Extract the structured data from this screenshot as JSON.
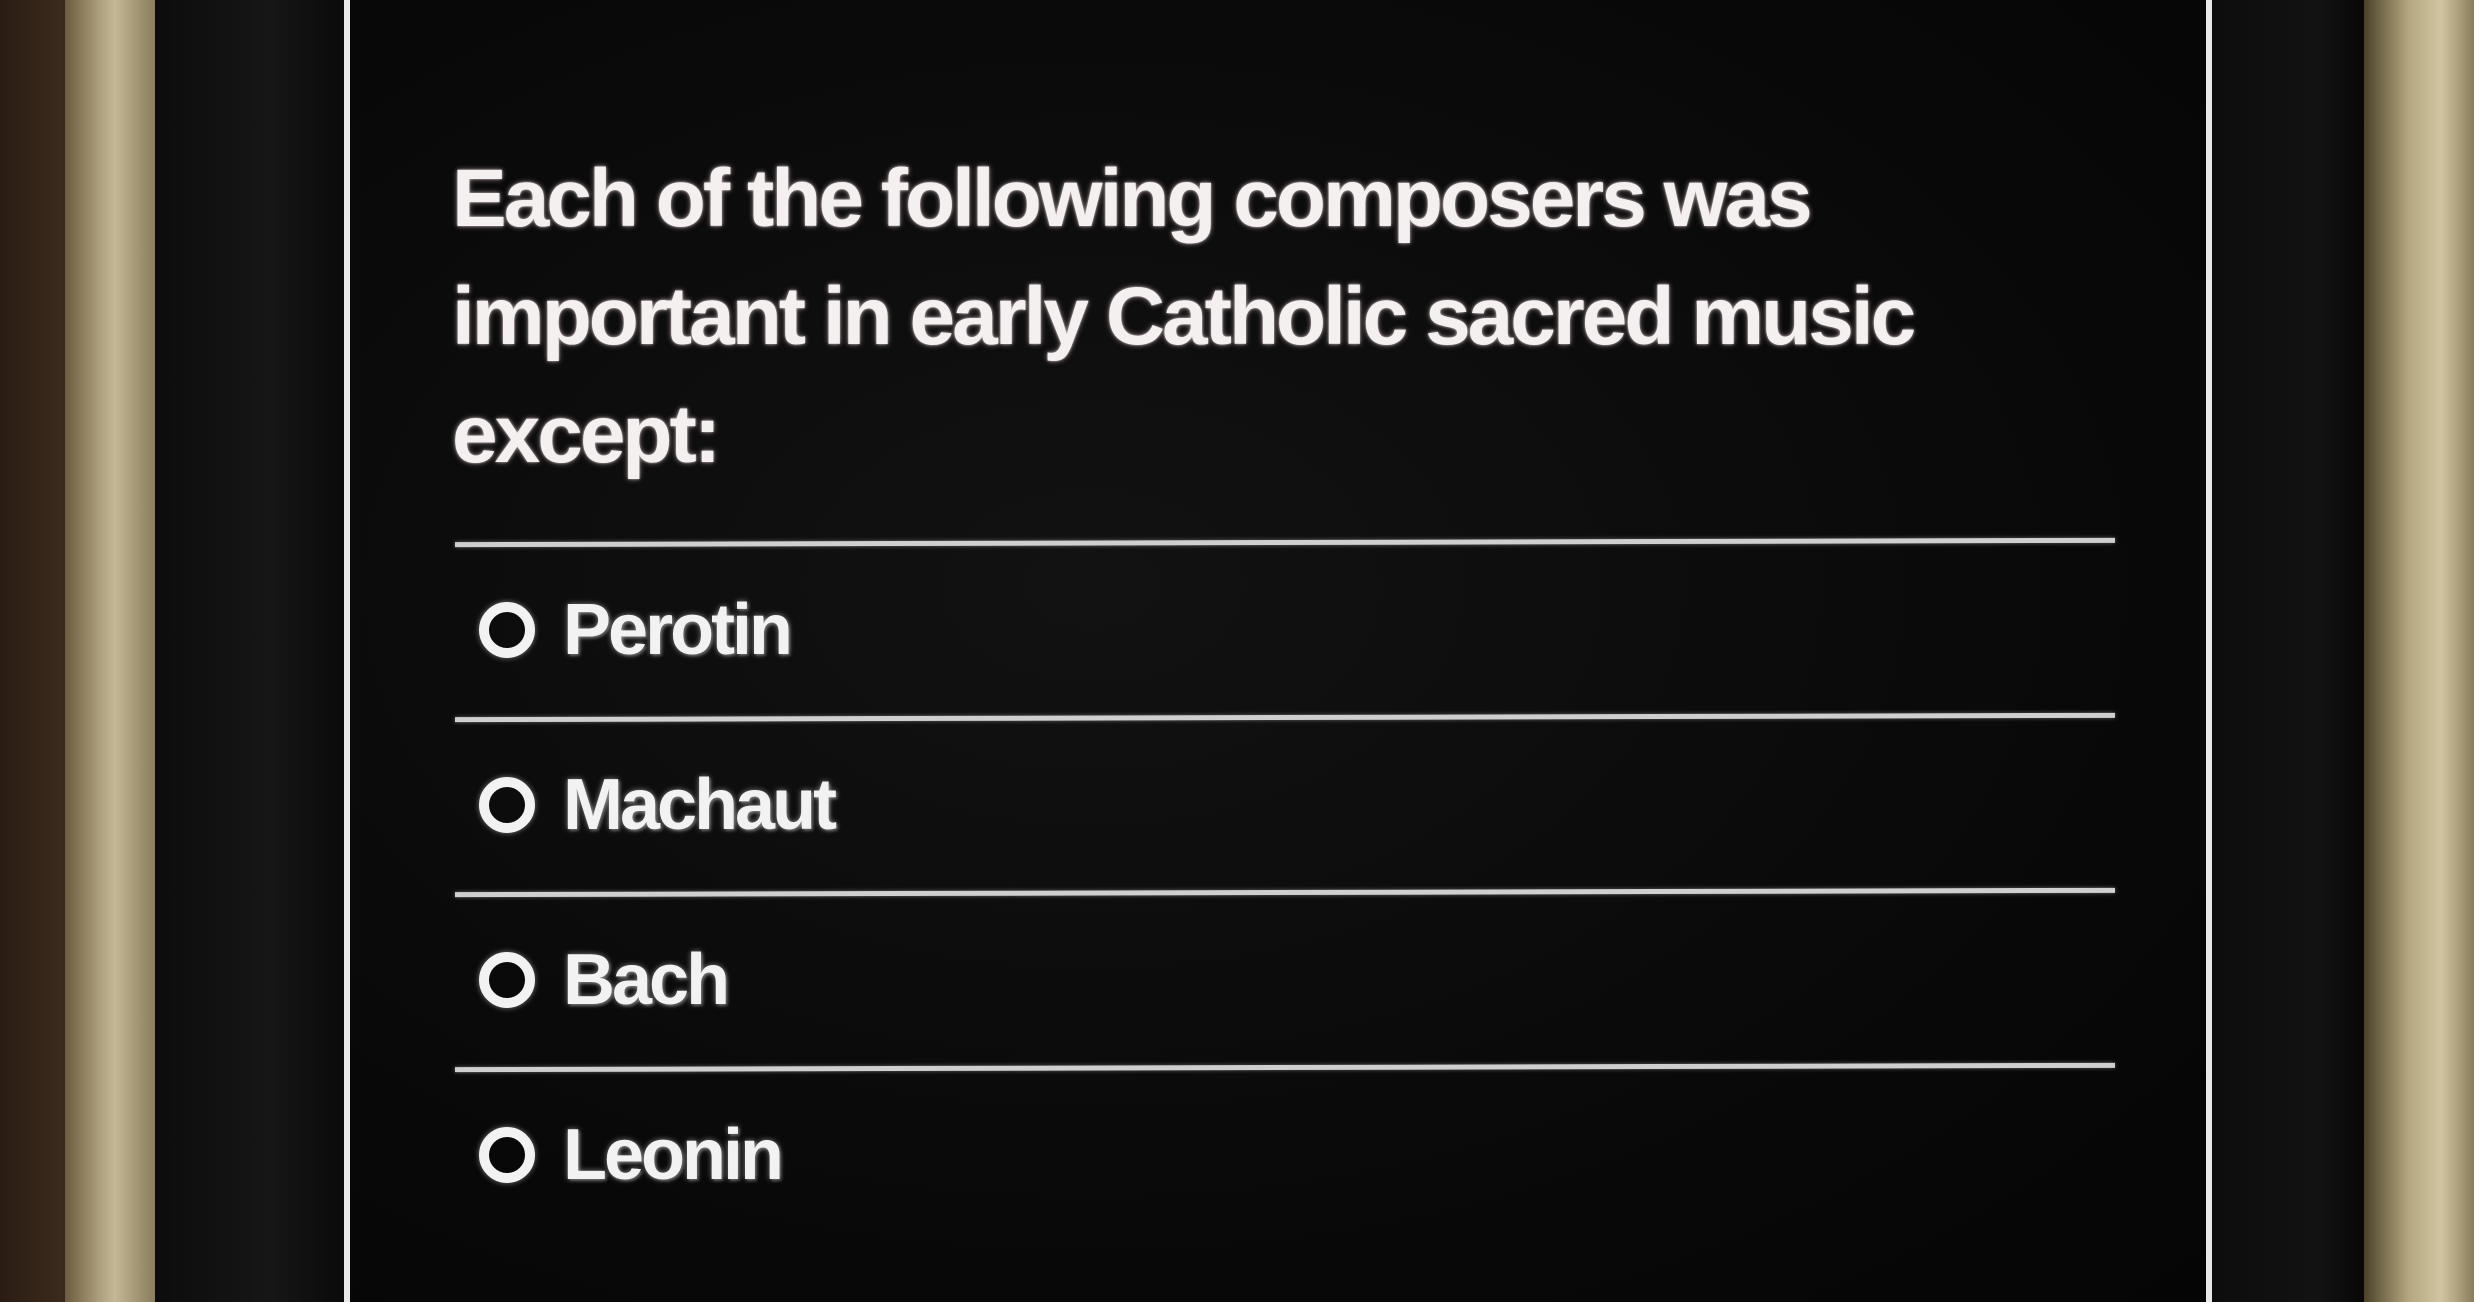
{
  "quiz": {
    "question": "Each of the following composers was important in early Catholic sacred music except:",
    "options": [
      {
        "label": "Perotin",
        "selected": false
      },
      {
        "label": "Machaut",
        "selected": false
      },
      {
        "label": "Bach",
        "selected": false
      },
      {
        "label": "Leonin",
        "selected": false
      }
    ]
  },
  "colors": {
    "background": "#080808",
    "text": "#f2f2f2",
    "divider": "#cfcfcf"
  }
}
